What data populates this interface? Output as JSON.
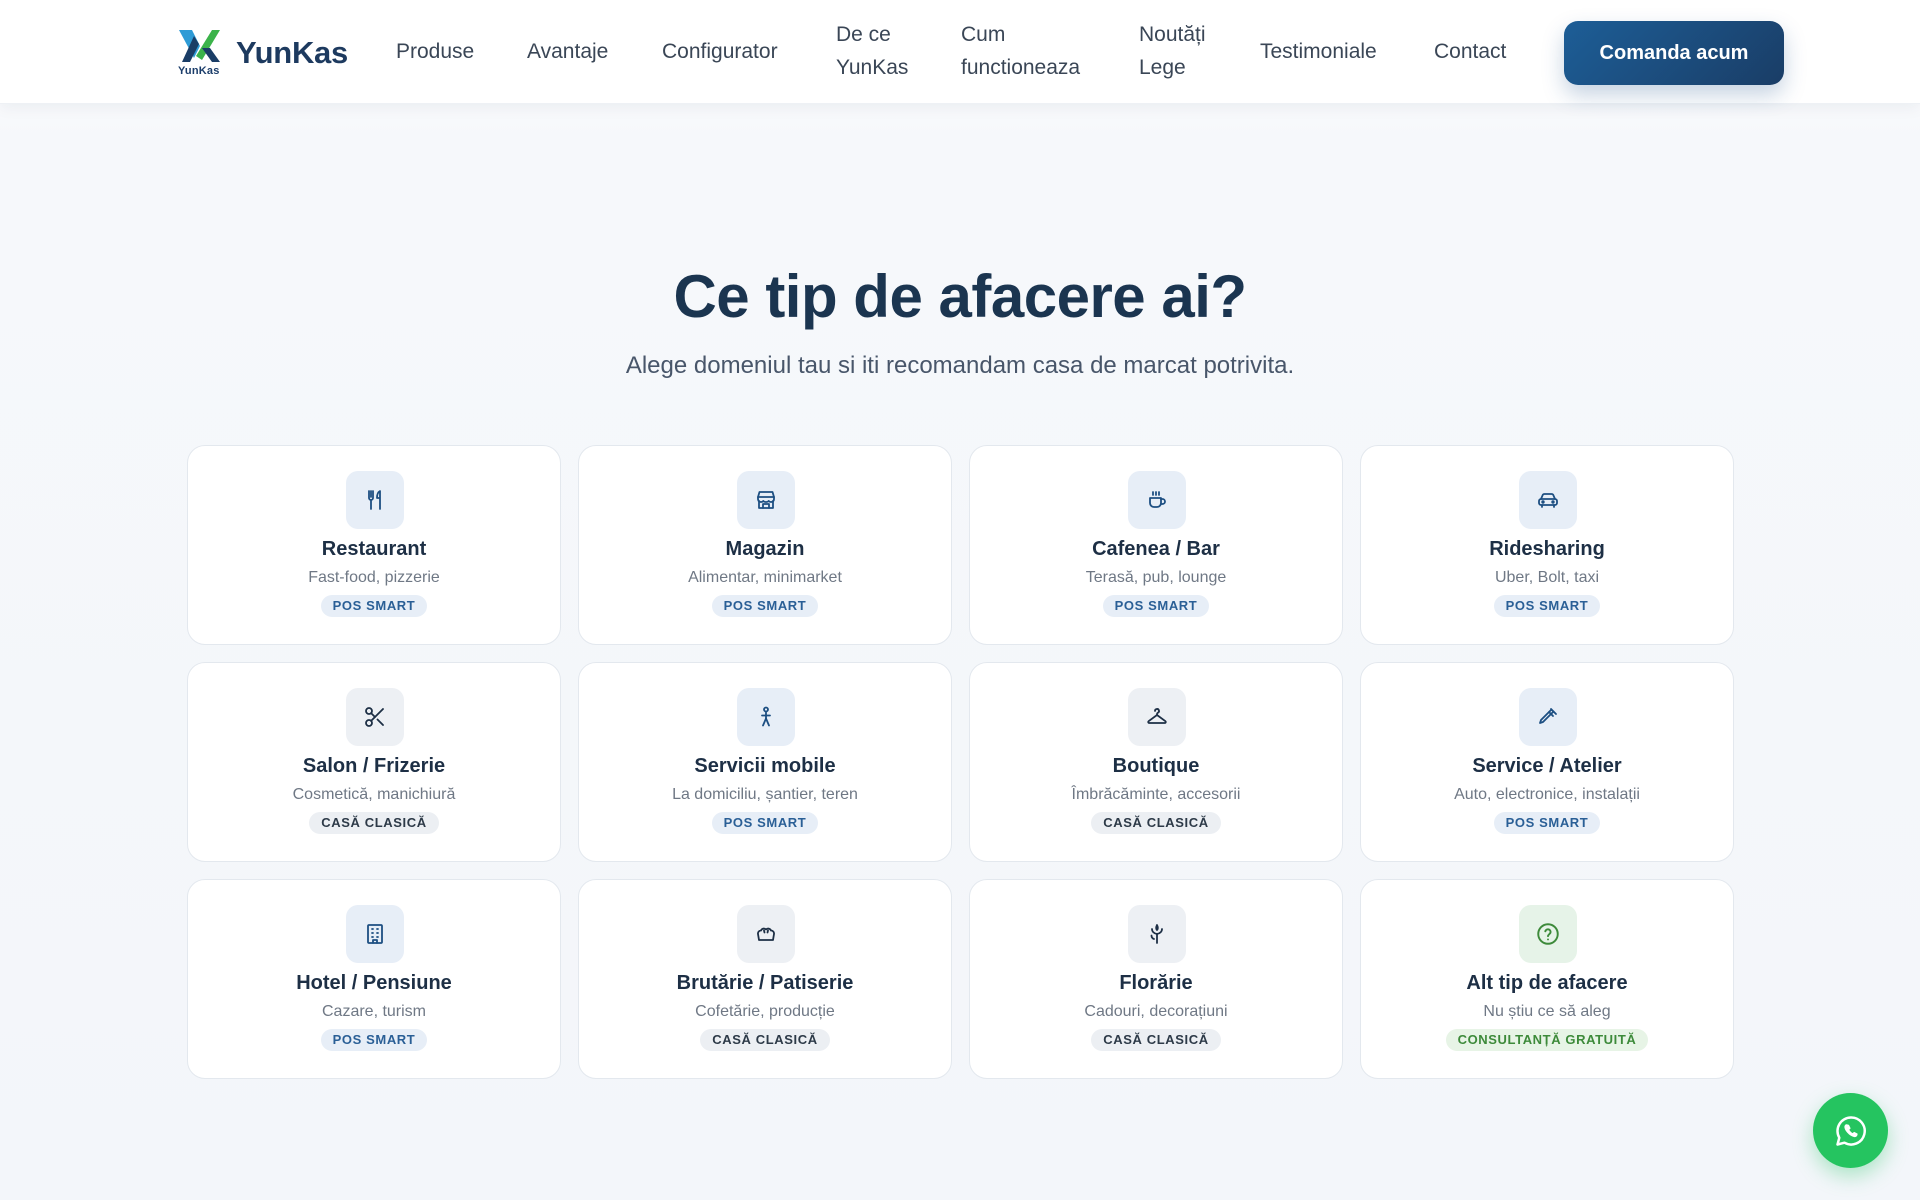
{
  "brand": {
    "name": "YunKas",
    "mark_text": "YunKas",
    "colors": {
      "primary": "#1a3d66",
      "accent": "#2e9bd6",
      "green": "#3bb34a"
    }
  },
  "nav": {
    "items": [
      {
        "line1": "Produse",
        "line2": ""
      },
      {
        "line1": "Avantaje",
        "line2": ""
      },
      {
        "line1": "Configurator",
        "line2": ""
      },
      {
        "line1": "De ce",
        "line2": "YunKas"
      },
      {
        "line1": "Cum",
        "line2": "functioneaza"
      },
      {
        "line1": "Noutăți",
        "line2": "Lege"
      },
      {
        "line1": "Testimoniale",
        "line2": ""
      },
      {
        "line1": "Contact",
        "line2": ""
      }
    ],
    "cta_label": "Comanda acum"
  },
  "section": {
    "title": "Ce tip de afacere ai?",
    "subtitle": "Alege domeniul tau si iti recomandam casa de marcat potrivita."
  },
  "cards": [
    {
      "title": "Restaurant",
      "desc": "Fast-food, pizzerie",
      "badge": "POS SMART",
      "icon": "utensils-icon"
    },
    {
      "title": "Magazin",
      "desc": "Alimentar, minimarket",
      "badge": "POS SMART",
      "icon": "store-icon"
    },
    {
      "title": "Cafenea / Bar",
      "desc": "Terasă, pub, lounge",
      "badge": "POS SMART",
      "icon": "coffee-icon"
    },
    {
      "title": "Ridesharing",
      "desc": "Uber, Bolt, taxi",
      "badge": "POS SMART",
      "icon": "car-icon"
    },
    {
      "title": "Salon / Frizerie",
      "desc": "Cosmetică, manichiură",
      "badge": "CASĂ CLASICĂ",
      "icon": "scissors-icon"
    },
    {
      "title": "Servicii mobile",
      "desc": "La domiciliu, șantier, teren",
      "badge": "POS SMART",
      "icon": "person-icon"
    },
    {
      "title": "Boutique",
      "desc": "Îmbrăcăminte, accesorii",
      "badge": "CASĂ CLASICĂ",
      "icon": "hanger-icon"
    },
    {
      "title": "Service / Atelier",
      "desc": "Auto, electronice, instalații",
      "badge": "POS SMART",
      "icon": "wrench-icon"
    },
    {
      "title": "Hotel / Pensiune",
      "desc": "Cazare, turism",
      "badge": "POS SMART",
      "icon": "building-icon"
    },
    {
      "title": "Brutărie / Patiserie",
      "desc": "Cofetărie, producție",
      "badge": "CASĂ CLASICĂ",
      "icon": "bread-icon"
    },
    {
      "title": "Florărie",
      "desc": "Cadouri, decorațiuni",
      "badge": "CASĂ CLASICĂ",
      "icon": "flower-icon"
    },
    {
      "title": "Alt tip de afacere",
      "desc": "Nu știu ce să aleg",
      "badge": "CONSULTANȚĂ GRATUITĂ",
      "icon": "question-icon"
    }
  ],
  "whatsapp": {
    "icon": "whatsapp-icon",
    "color": "#25c460"
  }
}
